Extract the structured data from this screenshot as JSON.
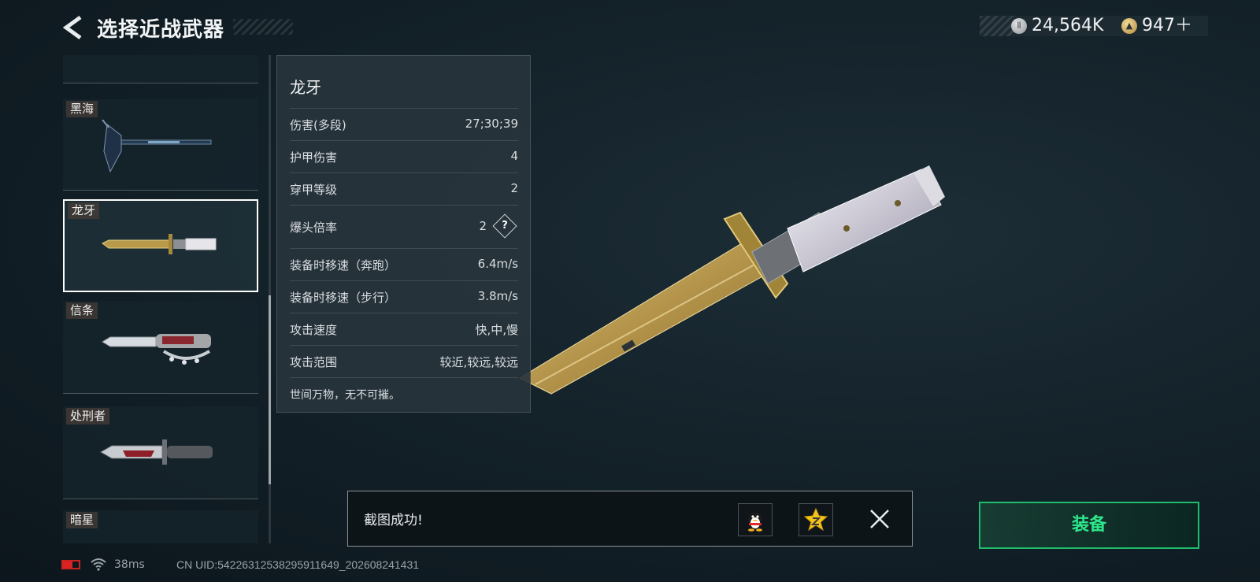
{
  "header": {
    "title": "选择近战武器",
    "currency_silver": "24,564K",
    "currency_gold": "947＋"
  },
  "weapon_list": [
    {
      "name": ""
    },
    {
      "name": "黑海"
    },
    {
      "name": "龙牙",
      "selected": true
    },
    {
      "name": "信条"
    },
    {
      "name": "处刑者"
    },
    {
      "name": "暗星"
    }
  ],
  "details": {
    "name": "龙牙",
    "stats": [
      {
        "label": "伤害(多段)",
        "value": "27;30;39"
      },
      {
        "label": "护甲伤害",
        "value": "4"
      },
      {
        "label": "穿甲等级",
        "value": "2"
      },
      {
        "label": "爆头倍率",
        "value": "2"
      },
      {
        "label": "装备时移速（奔跑）",
        "value": "6.4m/s"
      },
      {
        "label": "装备时移速（步行）",
        "value": "3.8m/s"
      },
      {
        "label": "攻击速度",
        "value": "快,中,慢"
      },
      {
        "label": "攻击范围",
        "value": "较近,较远,较远"
      }
    ],
    "help_symbol": "?",
    "flavor": "世间万物，无不可摧。"
  },
  "toast": {
    "message": "截图成功!"
  },
  "equip_label": "装备",
  "status": {
    "ping": "38ms",
    "uid": "CN UID:54226312538295911649_202608241431"
  },
  "colors": {
    "accent_green": "#2ee88c",
    "gold": "#c9a24a"
  }
}
